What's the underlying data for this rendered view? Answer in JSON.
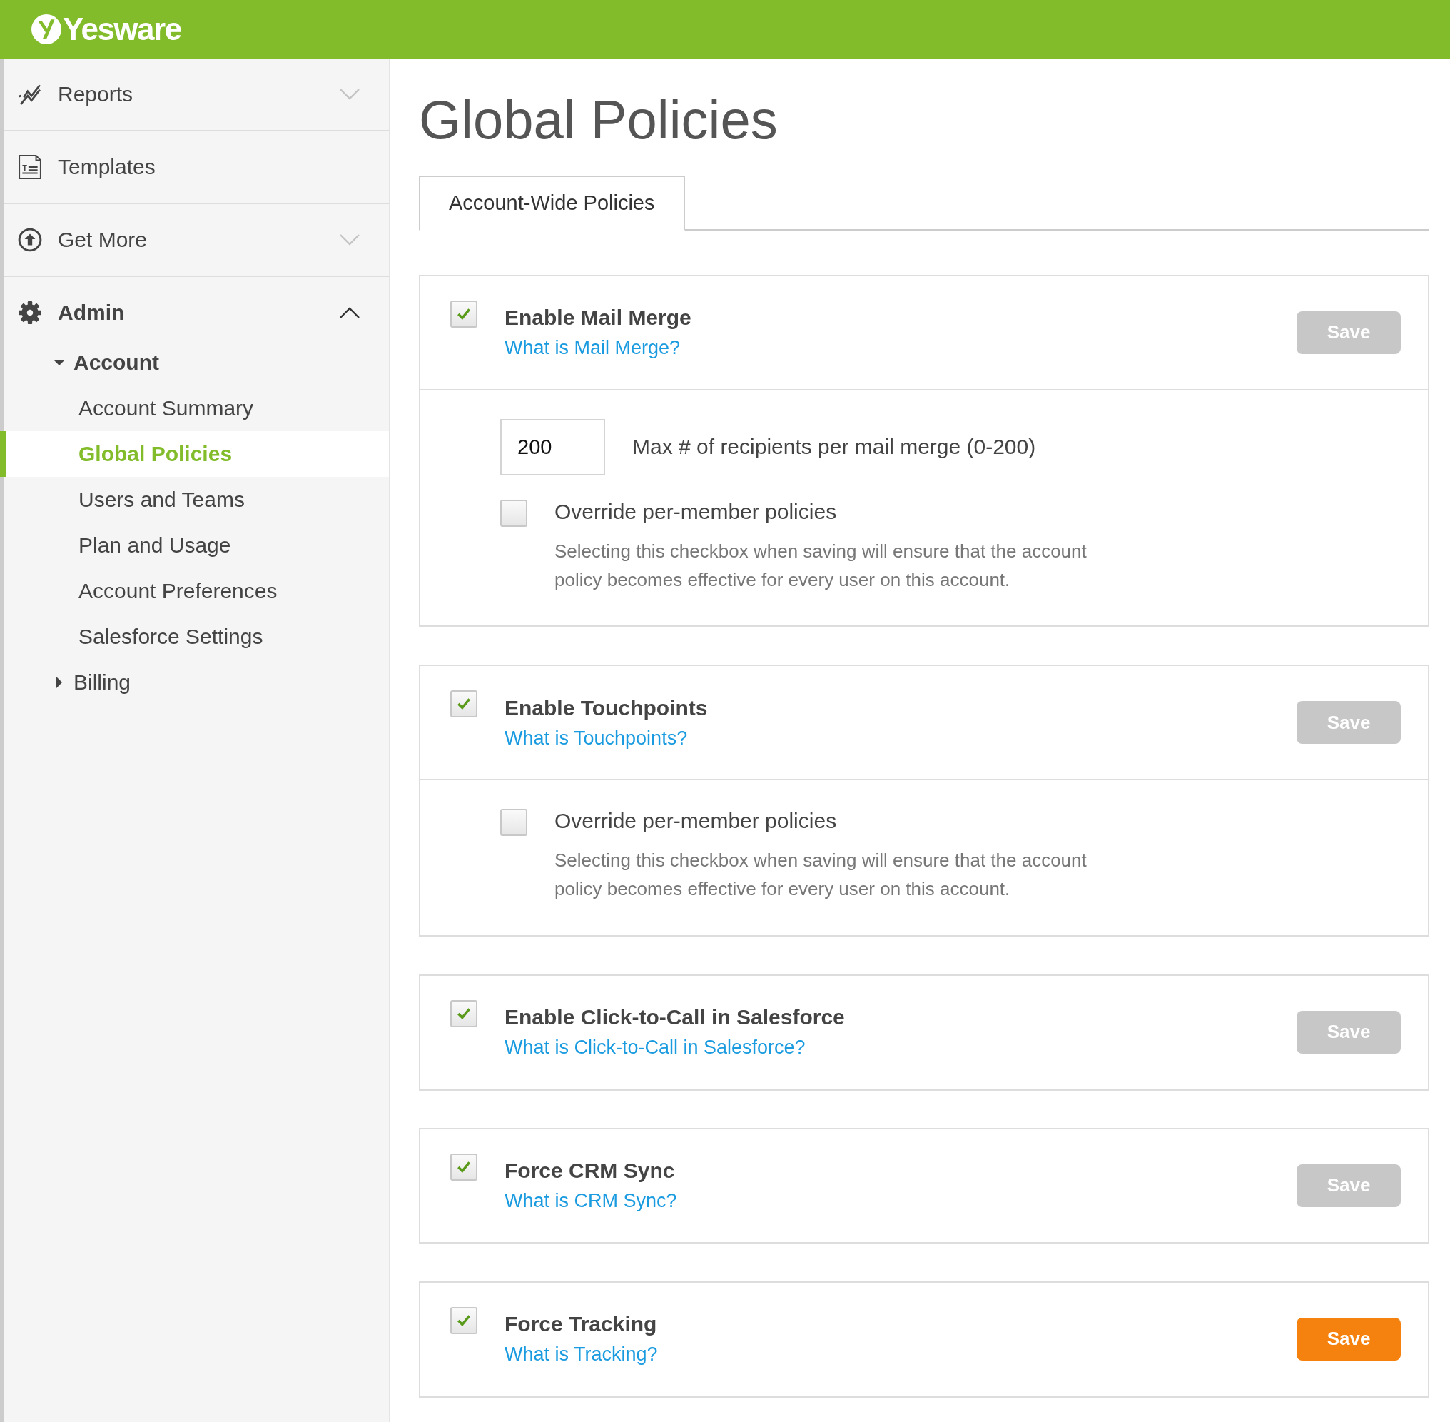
{
  "header": {
    "logo": "Yesware"
  },
  "sidebar": {
    "items": [
      {
        "label": "Reports",
        "kind": "chart",
        "expanded": false
      },
      {
        "label": "Templates",
        "kind": "document"
      },
      {
        "label": "Get More",
        "kind": "upload",
        "expanded": false
      },
      {
        "label": "Admin",
        "kind": "gear",
        "expanded": true,
        "children": [
          {
            "label": "Account",
            "expanded": true,
            "children": [
              {
                "label": "Account Summary",
                "selected": false
              },
              {
                "label": "Global Policies",
                "selected": true
              },
              {
                "label": "Users and Teams",
                "selected": false
              },
              {
                "label": "Plan and Usage",
                "selected": false
              },
              {
                "label": "Account Preferences",
                "selected": false
              },
              {
                "label": "Salesforce Settings",
                "selected": false
              }
            ]
          },
          {
            "label": "Billing",
            "expanded": false
          }
        ]
      }
    ]
  },
  "page": {
    "title": "Global Policies",
    "tabs": [
      {
        "label": "Account-Wide Policies",
        "selected": true
      }
    ],
    "policies": [
      {
        "title": "Enable Mail Merge",
        "link": "What is Mail Merge?",
        "checked": true,
        "save": {
          "label": "Save",
          "disabled": true
        },
        "limit": {
          "value": "200",
          "label": "Max # of recipients per mail merge (0-200)"
        },
        "override": {
          "checked": false,
          "label": "Override per-member policies",
          "note": "Selecting this checkbox when saving will ensure that the account policy becomes effective for every user on this account."
        }
      },
      {
        "title": "Enable Touchpoints",
        "link": "What is Touchpoints?",
        "checked": true,
        "save": {
          "label": "Save",
          "disabled": true
        },
        "override": {
          "checked": false,
          "label": "Override per-member policies",
          "note": "Selecting this checkbox when saving will ensure that the account policy becomes effective for every user on this account."
        }
      },
      {
        "title": "Enable Click-to-Call in Salesforce",
        "link": "What is Click-to-Call in Salesforce?",
        "checked": true,
        "save": {
          "label": "Save",
          "disabled": true
        }
      },
      {
        "title": "Force CRM Sync",
        "link": "What is CRM Sync?",
        "checked": true,
        "save": {
          "label": "Save",
          "disabled": true
        }
      },
      {
        "title": "Force Tracking",
        "link": "What is Tracking?",
        "checked": true,
        "save": {
          "label": "Save",
          "disabled": false
        }
      }
    ]
  }
}
